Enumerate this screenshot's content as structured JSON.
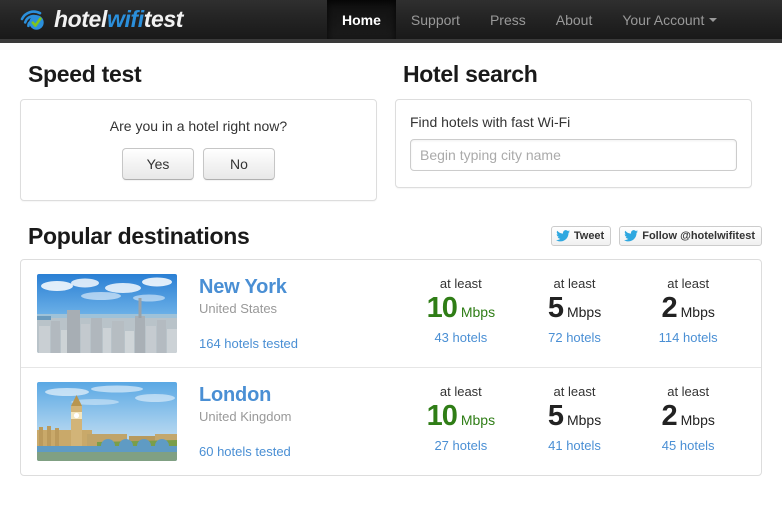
{
  "brand": {
    "icon": "wifi-check-icon",
    "part1": "hotel",
    "part2": "wifi",
    "part3": "test",
    "accent_color": "#2b8fdb"
  },
  "nav": {
    "items": [
      {
        "label": "Home",
        "active": true
      },
      {
        "label": "Support",
        "active": false
      },
      {
        "label": "Press",
        "active": false
      },
      {
        "label": "About",
        "active": false
      },
      {
        "label": "Your Account",
        "active": false,
        "caret": true
      }
    ]
  },
  "speed_test": {
    "title": "Speed test",
    "question": "Are you in a hotel right now?",
    "yes_label": "Yes",
    "no_label": "No"
  },
  "hotel_search": {
    "title": "Hotel search",
    "label": "Find hotels with fast Wi-Fi",
    "input_value": "",
    "placeholder": "Begin typing city name"
  },
  "popular": {
    "title": "Popular destinations",
    "social": [
      {
        "icon": "twitter-bird-icon",
        "label": "Tweet"
      },
      {
        "icon": "twitter-bird-icon",
        "label": "Follow @hotelwifitest"
      }
    ],
    "destinations": [
      {
        "thumb": "new-york-skyline-photo",
        "city": "New York",
        "country": "United States",
        "tested": "164 hotels tested",
        "speeds": [
          {
            "prefix": "at least",
            "value": "10",
            "unit": "Mbps",
            "count": "43 hotels",
            "color": "#2f7d16"
          },
          {
            "prefix": "at least",
            "value": "5",
            "unit": "Mbps",
            "count": "72 hotels",
            "color": "#222222"
          },
          {
            "prefix": "at least",
            "value": "2",
            "unit": "Mbps",
            "count": "114 hotels",
            "color": "#222222"
          }
        ]
      },
      {
        "thumb": "london-big-ben-photo",
        "city": "London",
        "country": "United Kingdom",
        "tested": "60 hotels tested",
        "speeds": [
          {
            "prefix": "at least",
            "value": "10",
            "unit": "Mbps",
            "count": "27 hotels",
            "color": "#2f7d16"
          },
          {
            "prefix": "at least",
            "value": "5",
            "unit": "Mbps",
            "count": "41 hotels",
            "color": "#222222"
          },
          {
            "prefix": "at least",
            "value": "2",
            "unit": "Mbps",
            "count": "45 hotels",
            "color": "#222222"
          }
        ]
      }
    ]
  }
}
